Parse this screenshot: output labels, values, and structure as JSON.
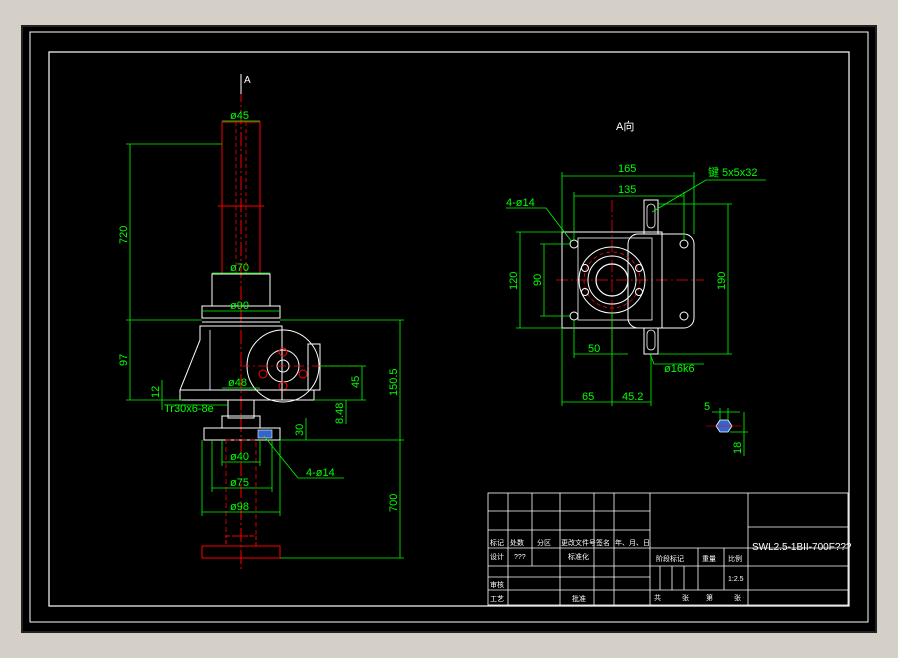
{
  "colors": {
    "outer_bg": "#d4d0c8",
    "canvas": "#000000",
    "frame": "#ffffff",
    "drawing": "#ffffff",
    "dimension": "#00ff00",
    "centerline": "#ff0000",
    "hidden": "#ff0000",
    "part_fill": "#ff0000",
    "table_line": "#ffffff",
    "title_text": "#ffffff"
  },
  "view_labels": {
    "side_view_marker": "A",
    "top_view_title": "A向"
  },
  "side_view_dims": {
    "d45": "ø45",
    "d70": "ø70",
    "d90": "ø90",
    "d48": "ø48",
    "d40": "ø40",
    "d75": "ø75",
    "d98": "ø98",
    "len720": "720",
    "len97": "97",
    "len12": "12",
    "thread": "Tr30x6-8e",
    "len45": "45",
    "len1505": "150.5",
    "len848": "8.48",
    "len30": "30",
    "len700": "700",
    "holes": "4-ø14"
  },
  "top_view_dims": {
    "w165": "165",
    "w135": "135",
    "key": "键 5x5x32",
    "holes": "4-ø14",
    "h120": "120",
    "h90": "90",
    "h190": "190",
    "w50": "50",
    "shaft": "ø16k6",
    "w65": "65",
    "w452": "45.2"
  },
  "key_detail": {
    "w5": "5",
    "h18": "18"
  },
  "title_block": {
    "col_biaoji": "标记",
    "col_chushu": "处数",
    "col_fenqu": "分区",
    "col_genggai": "更改文件号",
    "col_qianming": "签名",
    "col_date": "年、月、日",
    "row_sheji": "设计",
    "sheji_value": "???",
    "row_biaozhunhua": "标准化",
    "row_shenhe": "审核",
    "row_gongyi": "工艺",
    "row_pizhun": "批准",
    "jieduan": "阶段标记",
    "zhongliang": "重量",
    "bili": "比例",
    "scale": "1:2.5",
    "gong": "共",
    "zhang": "张",
    "di": "第",
    "zhang2": "张",
    "drawing_title": "SWL2.5-1BII-700F???"
  }
}
